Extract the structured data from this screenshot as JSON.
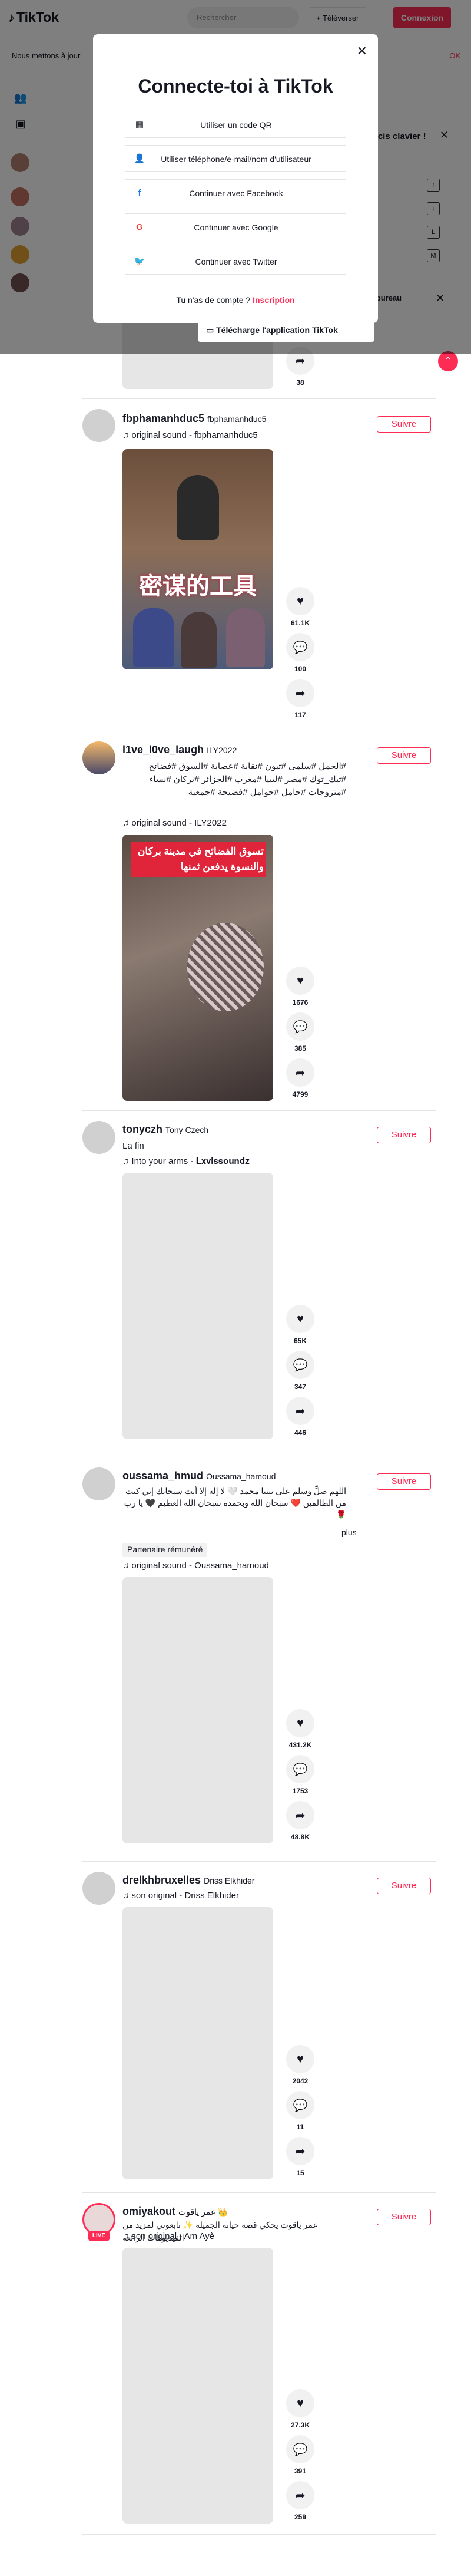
{
  "header": {
    "logo": "TikTok",
    "search_placeholder": "Rechercher",
    "upload_label": "Téléverser",
    "login_label": "Connexion"
  },
  "banner": {
    "text": "Nous mettons à jour",
    "ok": "OK"
  },
  "shortcuts": {
    "title": "rcis clavier !",
    "keys": [
      "↑",
      "↓",
      "L",
      "M"
    ],
    "desktop_text": "de bureau"
  },
  "modal": {
    "title": "Connecte-toi à TikTok",
    "options": [
      {
        "icon": "qr-code-icon",
        "label": "Utiliser un code QR"
      },
      {
        "icon": "person-icon",
        "label": "Utiliser téléphone/e-mail/nom d'utilisateur"
      },
      {
        "icon": "facebook-icon",
        "label": "Continuer avec Facebook"
      },
      {
        "icon": "google-icon",
        "label": "Continuer avec Google"
      },
      {
        "icon": "twitter-icon",
        "label": "Continuer avec Twitter"
      }
    ],
    "footer_text": "Tu n'as de compte ?",
    "footer_link": "Inscription"
  },
  "getapp": {
    "label": "Télécharge l'application TikTok"
  },
  "accent": "#fe2c55",
  "follow_label": "Suivre",
  "first_partial": {
    "share": "38"
  },
  "posts": [
    {
      "user": "fbphamanhduc5",
      "nick": "fbphamanhduc5",
      "caption": "",
      "sound": "original sound - fbphamanhduc5",
      "likes": "61.1K",
      "comments": "100",
      "shares": "117",
      "thumb_text": "密谋的工具"
    },
    {
      "user": "l1ve_l0ve_laugh",
      "nick": "ILY2022",
      "caption": "#الحمل #سلمى #تبون #نقابة #عصابة #السوق #فضائح #تيك_توك #مصر #ليبيا #مغرب #الجزائر #بركان #نساء #متزوجات #حامل #حوامل #فضيحة #جمعية",
      "sound": "original sound - ILY2022",
      "likes": "1676",
      "comments": "385",
      "shares": "4799",
      "thumb_text": "تسوق الفضائح في مدينة بركان والنسوة يدفعن ثمنها"
    },
    {
      "user": "tonyczh",
      "nick": "Tony Czech",
      "caption": "La fin",
      "caption2": "Into your arms - 𝐋𝐱𝐯𝐢𝐬𝐬𝐨𝐮𝐧𝐝𝐳",
      "likes": "65K",
      "comments": "347",
      "shares": "446"
    },
    {
      "user": "oussama_hmud",
      "nick": "Oussama_hamoud",
      "caption": "اللهم صلِّ وسلم على نبينا محمد 🤍 لا إله إلا أنت سبحانك إني كنت من الظالمين ❤️ سبحان الله وبحمده سبحان الله العظيم 🖤 يا رب 🌹",
      "more": "plus",
      "partner": "Partenaire rémunéré",
      "sound": "original sound - Oussama_hamoud",
      "likes": "431.2K",
      "comments": "1753",
      "shares": "48.8K"
    },
    {
      "user": "drelkhbruxelles",
      "nick": "Driss Elkhider",
      "caption": "",
      "sound": "son original - Driss Elkhider",
      "likes": "2042",
      "comments": "11",
      "shares": "15"
    },
    {
      "user": "omiyakout",
      "nick": "عمر ياقوت 👑",
      "caption": "عمر ياقوت يحكي قصة حياته الجميلة ✨ تابعوني لمزيد من الفيديوهات الرائعة",
      "sound": "son original - Am Ayè",
      "likes": "27.3K",
      "comments": "391",
      "shares": "259",
      "live": "LIVE"
    }
  ]
}
